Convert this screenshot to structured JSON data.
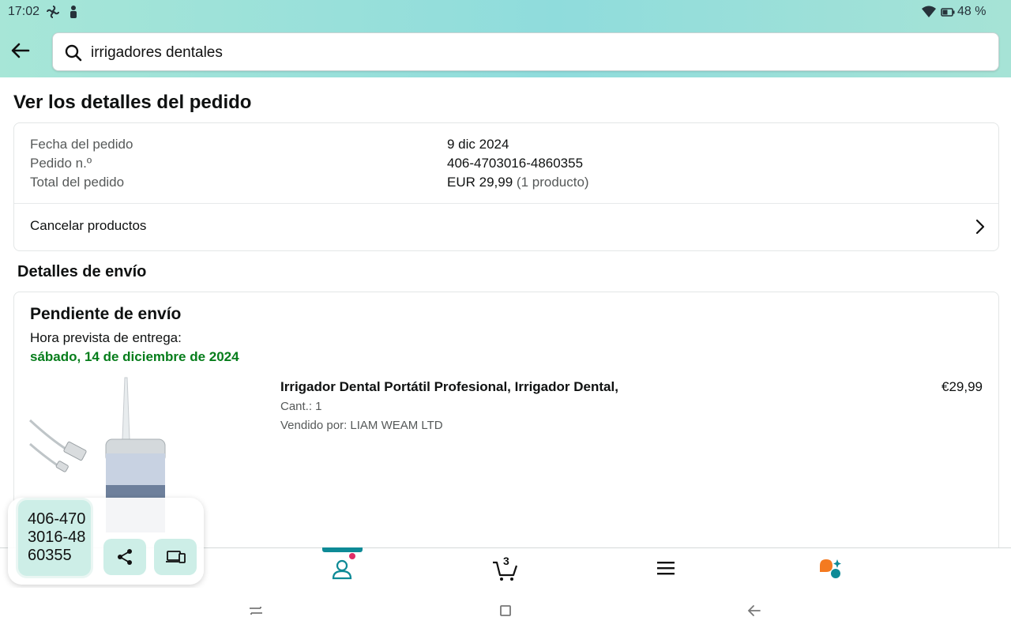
{
  "status_bar": {
    "time": "17:02",
    "battery": "48 %"
  },
  "search": {
    "query": "irrigadores dentales"
  },
  "page": {
    "title": "Ver los detalles del pedido"
  },
  "order_summary": {
    "date_label": "Fecha del pedido",
    "date_value": "9 dic 2024",
    "number_label": "Pedido n.º",
    "number_value": "406-4703016-4860355",
    "total_label": "Total del pedido",
    "total_value": "EUR 29,99",
    "total_count": "(1 producto)",
    "cancel_label": "Cancelar productos"
  },
  "shipping": {
    "section_title": "Detalles de envío",
    "status": "Pendiente de envío",
    "eta_label": "Hora prevista de entrega:",
    "eta_date": "sábado, 14 de diciembre de 2024",
    "eta_color": "#067d1b"
  },
  "product": {
    "title": "Irrigador Dental Portátil Profesional, Irrigador Dental,",
    "quantity": "Cant.: 1",
    "seller": "Vendido por: LIAM WEAM LTD",
    "price": "€29,99"
  },
  "bottom_nav": {
    "items": [
      "home-icon",
      "account-icon",
      "cart-icon",
      "menu-icon",
      "assistant-icon"
    ],
    "active": "account-icon",
    "cart_count": "3",
    "accent": "#0e8a96"
  },
  "floating_panel": {
    "copied_text": "406-4703016-4860355",
    "copied_text_wrapped": [
      "406-470",
      "3016-48",
      "60355"
    ],
    "buttons": [
      "share-icon",
      "devices-icon"
    ]
  }
}
